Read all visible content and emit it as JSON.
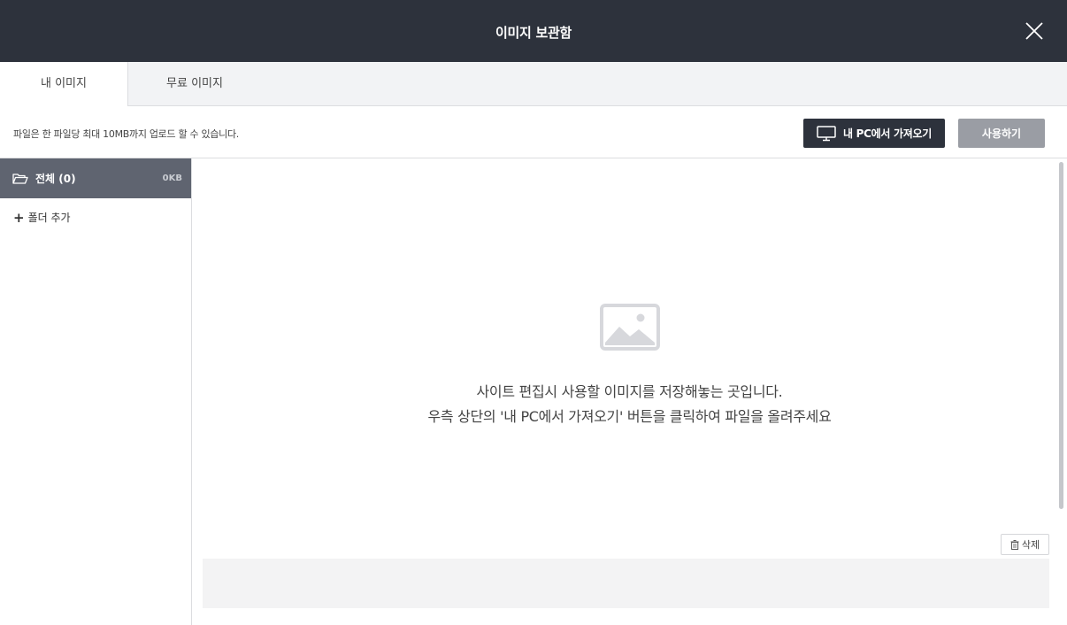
{
  "header": {
    "title": "이미지 보관함"
  },
  "tabs": [
    {
      "label": "내 이미지"
    },
    {
      "label": "무료 이미지"
    }
  ],
  "toolbar": {
    "notice": "파일은 한 파일당 최대 10MB까지 업로드 할 수 있습니다.",
    "import_label": "내 PC에서 가져오기",
    "use_label": "사용하기"
  },
  "sidebar": {
    "folder_all_label": "전체 (0)",
    "folder_all_size": "0KB",
    "add_folder_label": "폴더 추가"
  },
  "main": {
    "empty_line_1": "사이트 편집시 사용할 이미지를 저장해놓는 곳입니다.",
    "empty_line_2": "우측 상단의 '내 PC에서 가져오기' 버튼을 클릭하여 파일을 올려주세요",
    "delete_label": "삭제"
  },
  "icons": {
    "close": "close-icon",
    "monitor": "monitor-icon",
    "folder": "folder-open-icon",
    "plus": "plus-icon",
    "image": "image-placeholder-icon",
    "trash": "trash-icon"
  },
  "colors": {
    "header_bg": "#2d323c",
    "active_folder_bg": "#5f6470",
    "disabled_button": "#9a9da4"
  }
}
